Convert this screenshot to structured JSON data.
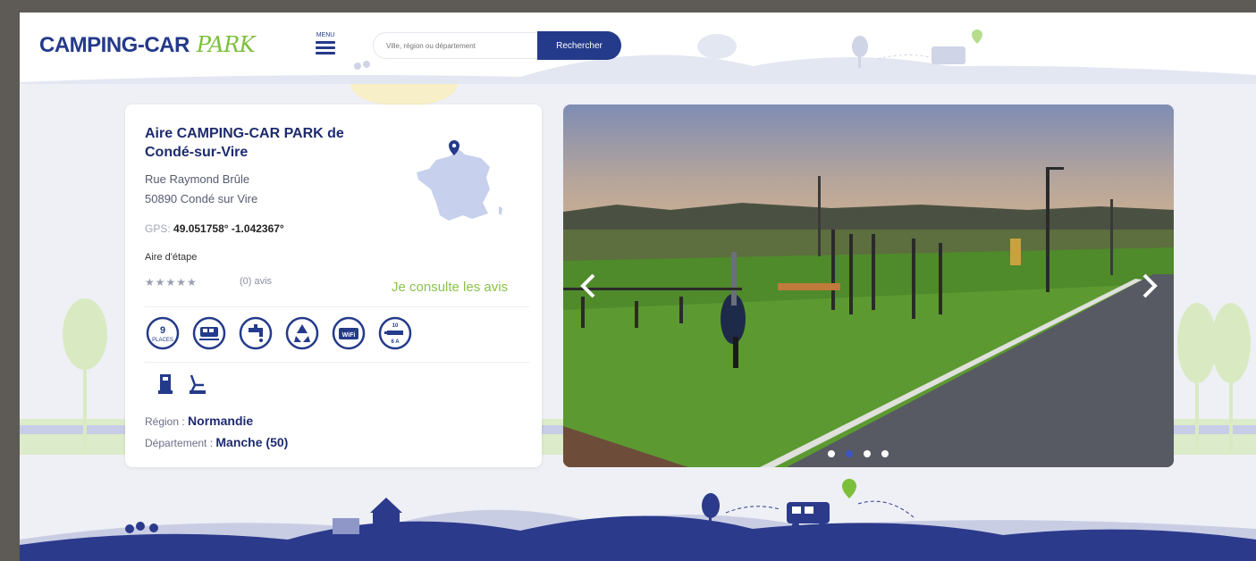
{
  "header": {
    "logo_main": "CAMPING-CAR",
    "logo_accent": "PARK",
    "menu_label": "MENU",
    "search_placeholder": "Ville, région ou département",
    "search_button": "Rechercher"
  },
  "aire": {
    "title": "Aire CAMPING-CAR PARK de Condé-sur-Vire",
    "street": "Rue Raymond Brûle",
    "city": "50890 Condé sur Vire",
    "gps_label": "GPS:",
    "gps_value": "49.051758° -1.042367°",
    "type": "Aire d'étape",
    "stars": "★★★★★",
    "reviews": "(0) avis",
    "consult_link": "Je consulte les avis",
    "places_number": "9",
    "places_label": "PLACES",
    "wifi_label": "WiFi",
    "electricity_amps": "10",
    "electricity_unit": "6 A",
    "region_label": "Région :",
    "region": "Normandie",
    "department_label": "Département :",
    "department": "Manche (50)"
  },
  "services": [
    "places-icon",
    "camper-service-icon",
    "water-tap-icon",
    "recycling-icon",
    "wifi-icon",
    "electricity-icon"
  ],
  "extra_services": [
    "terminal-icon",
    "waste-disposal-icon"
  ],
  "carousel": {
    "slide_count": 4,
    "active_slide": 2
  },
  "colors": {
    "brand_blue": "#243a8a",
    "brand_green": "#8bc24a",
    "scenery_blue": "#2c3a8c"
  }
}
